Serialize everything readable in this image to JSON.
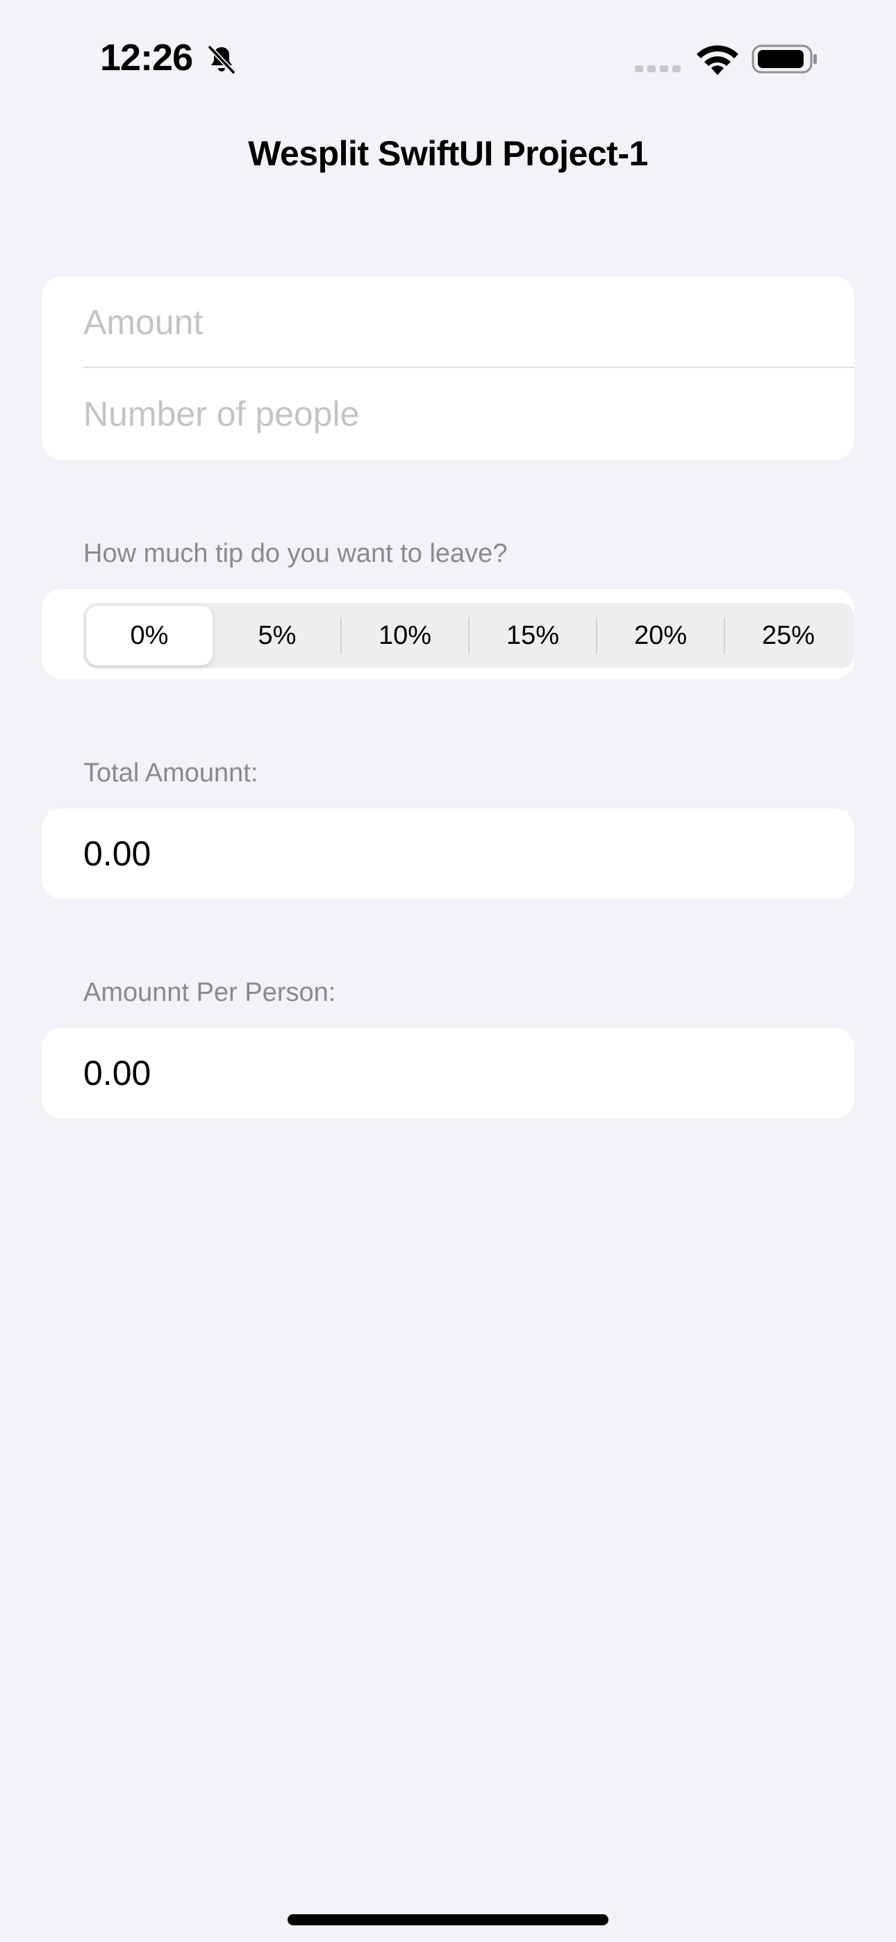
{
  "status_bar": {
    "time": "12:26",
    "icons": [
      "bell-slash-icon",
      "cellular-signal-icon",
      "wifi-icon",
      "battery-icon"
    ]
  },
  "nav": {
    "title": "Wesplit SwiftUI Project-1"
  },
  "inputs": {
    "amount_placeholder": "Amount",
    "amount_value": "",
    "people_placeholder": "Number of people",
    "people_value": ""
  },
  "tip": {
    "header": "How much tip do you want to leave?",
    "options": [
      "0%",
      "5%",
      "10%",
      "15%",
      "20%",
      "25%"
    ],
    "selected": "0%"
  },
  "total": {
    "header": "Total Amounnt:",
    "value": "0.00"
  },
  "per_person": {
    "header": "Amounnt Per Person:",
    "value": "0.00"
  },
  "colors": {
    "background": "#f2f2f7",
    "card": "#ffffff",
    "secondary_text": "#8a8a8e",
    "placeholder": "#c4c4c7"
  }
}
